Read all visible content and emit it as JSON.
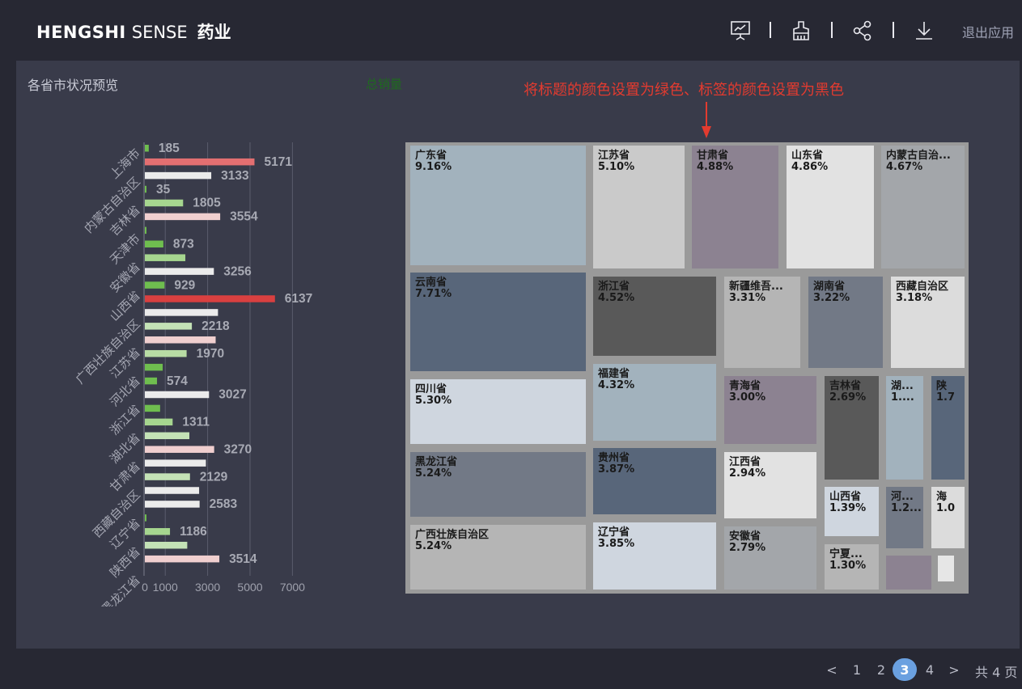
{
  "header": {
    "brand_hengshi": "HENGSHI",
    "brand_sense": "SENSE",
    "app_name": "药业",
    "exit_label": "退出应用",
    "icons": [
      "presentation-icon",
      "brush-icon",
      "share-icon",
      "download-icon"
    ]
  },
  "panel": {
    "title": "各省市状况预览",
    "treemap_title": "总销量",
    "annotation": "将标题的颜色设置为绿色、标签的颜色设置为黑色"
  },
  "colors": {
    "background": "#272833",
    "panel": "#393b4a",
    "treemap_title": "#1e6b1e",
    "annotation": "#e33b2f",
    "page_current": "#6aa0e0"
  },
  "chart_data": {
    "type": "bar",
    "orientation": "horizontal",
    "title": "各省市状况预览",
    "xlim": [
      0,
      7000
    ],
    "x_ticks": [
      "0",
      "1000",
      "3000",
      "5000",
      "7000"
    ],
    "categories": [
      {
        "label": "上海市",
        "bars": [
          {
            "value": 185,
            "color": "#6fbe4f",
            "label": "185"
          },
          {
            "value": 5171,
            "color": "#e36f71",
            "label": "5171"
          },
          {
            "value": 3133,
            "color": "#ebebeb",
            "label": "3133"
          }
        ]
      },
      {
        "label": "内蒙古自治区",
        "bars": [
          {
            "value": 35,
            "color": "#6fbe4f",
            "label": "35"
          },
          {
            "value": 1805,
            "color": "#a6d68f",
            "label": "1805"
          },
          {
            "value": 3554,
            "color": "#f0cfcf",
            "label": "3554"
          }
        ]
      },
      {
        "label": "吉林省",
        "bars": [
          {
            "value": 45,
            "color": "#6fbe4f",
            "label": ""
          },
          {
            "value": 873,
            "color": "#6fbe4f",
            "label": "873"
          },
          {
            "value": 1910,
            "color": "#a6d68f",
            "label": ""
          }
        ]
      },
      {
        "label": "天津市",
        "bars": [
          {
            "value": 3256,
            "color": "#ebebeb",
            "label": "3256"
          },
          {
            "value": 929,
            "color": "#6fbe4f",
            "label": "929"
          }
        ]
      },
      {
        "label": "安徽省",
        "bars": [
          {
            "value": 6137,
            "color": "#d94040",
            "label": "6137"
          },
          {
            "value": 3450,
            "color": "#ebebeb",
            "label": ""
          },
          {
            "value": 2218,
            "color": "#c4e2b6",
            "label": "2218"
          }
        ]
      },
      {
        "label": "山西省",
        "bars": [
          {
            "value": 3340,
            "color": "#f0cfcf",
            "label": ""
          },
          {
            "value": 1970,
            "color": "#b8dca4",
            "label": "1970"
          },
          {
            "value": 842,
            "color": "#6fbe4f",
            "label": ""
          }
        ]
      },
      {
        "label": "广西壮族自治区",
        "bars": [
          {
            "value": 574,
            "color": "#6fbe4f",
            "label": "574"
          },
          {
            "value": 3027,
            "color": "#ebebeb",
            "label": "3027"
          },
          {
            "value": 720,
            "color": "#6fbe4f",
            "label": ""
          }
        ]
      },
      {
        "label": "江苏省",
        "bars": [
          {
            "value": 1311,
            "color": "#a6d68f",
            "label": "1311"
          },
          {
            "value": 2100,
            "color": "#c4e2b6",
            "label": ""
          },
          {
            "value": 3270,
            "color": "#f0cfcf",
            "label": "3270"
          }
        ]
      },
      {
        "label": "河北省",
        "bars": [
          {
            "value": 2880,
            "color": "#ebebeb",
            "label": ""
          },
          {
            "value": 2129,
            "color": "#c4e2b6",
            "label": "2129"
          },
          {
            "value": 2560,
            "color": "#ebebeb",
            "label": ""
          }
        ]
      },
      {
        "label": "浙江省",
        "bars": [
          {
            "value": 2583,
            "color": "#ebebeb",
            "label": "2583"
          },
          {
            "value": 60,
            "color": "#6fbe4f",
            "label": ""
          },
          {
            "value": 1186,
            "color": "#a6d68f",
            "label": "1186"
          }
        ]
      },
      {
        "label": "湖北省",
        "bars": [
          {
            "value": 2000,
            "color": "#c4e2b6",
            "label": ""
          },
          {
            "value": 3514,
            "color": "#f0cfcf",
            "label": "3514"
          }
        ]
      },
      {
        "label": "甘肃省",
        "bars": []
      },
      {
        "label": "西藏自治区",
        "bars": []
      },
      {
        "label": "辽宁省",
        "bars": []
      },
      {
        "label": "陕西省",
        "bars": []
      },
      {
        "label": "黑龙江省",
        "bars": []
      }
    ]
  },
  "treemap": {
    "title": "总销量",
    "tiles": [
      {
        "name": "广东省",
        "pct": "9.16%",
        "color": "#a2b2bd"
      },
      {
        "name": "江苏省",
        "pct": "5.10%",
        "color": "#cacaca"
      },
      {
        "name": "甘肃省",
        "pct": "4.88%",
        "color": "#8c8291"
      },
      {
        "name": "山东省",
        "pct": "4.86%",
        "color": "#e2e2e2"
      },
      {
        "name": "内蒙古自治...",
        "pct": "4.67%",
        "color": "#a3a6aa"
      },
      {
        "name": "云南省",
        "pct": "7.71%",
        "color": "#58667a"
      },
      {
        "name": "浙江省",
        "pct": "4.52%",
        "color": "#595959"
      },
      {
        "name": "新疆维吾...",
        "pct": "3.31%",
        "color": "#b5b5b5"
      },
      {
        "name": "湖南省",
        "pct": "3.22%",
        "color": "#727986"
      },
      {
        "name": "西藏自治区",
        "pct": "3.18%",
        "color": "#dcdcdc"
      },
      {
        "name": "四川省",
        "pct": "5.30%",
        "color": "#cfd6df"
      },
      {
        "name": "福建省",
        "pct": "4.32%",
        "color": "#a2b2bd"
      },
      {
        "name": "青海省",
        "pct": "3.00%",
        "color": "#8c8291"
      },
      {
        "name": "吉林省",
        "pct": "2.69%",
        "color": "#595959"
      },
      {
        "name": "湖...",
        "pct": "1....",
        "color": "#a2b2bd"
      },
      {
        "name": "陕",
        "pct": "1.7",
        "color": "#58667a"
      },
      {
        "name": "黑龙江省",
        "pct": "5.24%",
        "color": "#727986"
      },
      {
        "name": "贵州省",
        "pct": "3.87%",
        "color": "#58667a"
      },
      {
        "name": "江西省",
        "pct": "2.94%",
        "color": "#e2e2e2"
      },
      {
        "name": "山西省",
        "pct": "1.39%",
        "color": "#cfd6df"
      },
      {
        "name": "河...",
        "pct": "1.2...",
        "color": "#727986"
      },
      {
        "name": "海",
        "pct": "1.0",
        "color": "#dcdcdc"
      },
      {
        "name": "广西壮族自治区",
        "pct": "5.24%",
        "color": "#b5b5b5"
      },
      {
        "name": "辽宁省",
        "pct": "3.85%",
        "color": "#cfd6df"
      },
      {
        "name": "安徽省",
        "pct": "2.79%",
        "color": "#a3a6aa"
      },
      {
        "name": "宁夏...",
        "pct": "1.30%",
        "color": "#b5b5b5"
      },
      {
        "name": "",
        "pct": "",
        "color": "#8c8291"
      },
      {
        "name": "",
        "pct": "",
        "color": "#e6e6e6"
      }
    ]
  },
  "pagination": {
    "pages": [
      "1",
      "2",
      "3",
      "4"
    ],
    "current": "3",
    "prev": "<",
    "next": ">",
    "total": "共 4 页"
  }
}
